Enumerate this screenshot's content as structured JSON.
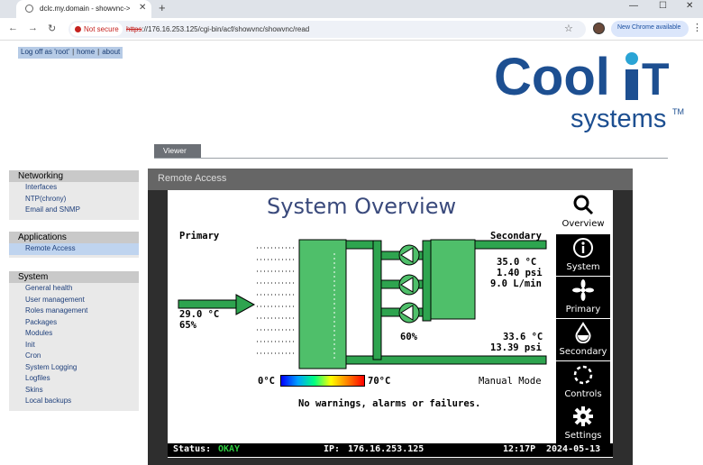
{
  "browser": {
    "tab_title": "dclc.my.domain - showvnc->re",
    "security_label": "Not secure",
    "url_scheme": "https",
    "url_rest": "://176.16.253.125/cgi-bin/acf/showvnc/showvnc/read",
    "new_chrome": "New Chrome available"
  },
  "top_links": [
    "Log off as 'root'",
    "home",
    "about"
  ],
  "logo": {
    "word1": "Cool",
    "word2": "IT",
    "word3": "systems",
    "tm": "TM"
  },
  "viewer_tab": "Viewer",
  "sidebar": [
    {
      "heading": "Networking",
      "items": [
        "Interfaces",
        "NTP(chrony)",
        "Email and SNMP"
      ]
    },
    {
      "heading": "Applications",
      "items": [
        "Remote Access"
      ]
    },
    {
      "heading": "System",
      "items": [
        "General health",
        "User management",
        "Roles management",
        "Packages",
        "Modules",
        "Init",
        "Cron",
        "System Logging",
        "Logfiles",
        "Skins",
        "Local backups"
      ]
    }
  ],
  "active_item": "Remote Access",
  "remote_access_title": "Remote Access",
  "overview": {
    "title": "System Overview",
    "primary_label": "Primary",
    "secondary_label": "Secondary",
    "inlet_temp": "29.0 °C",
    "inlet_humidity": "65%",
    "sec_temp_top": "35.0 °C",
    "sec_pressure_top": "1.40 psi",
    "sec_flow": "9.0 L/min",
    "pump_speed": "60%",
    "sec_temp_bottom": "33.6 °C",
    "sec_pressure_bottom": "13.39 psi",
    "scale_min": "0°C",
    "scale_max": "70°C",
    "mode": "Manual Mode",
    "message": "No warnings, alarms or failures."
  },
  "side_buttons": [
    "Overview",
    "System",
    "Primary",
    "Secondary",
    "Controls",
    "Settings"
  ],
  "status_bar": {
    "status_label": "Status:",
    "status_value": "OKAY",
    "ip_label": "IP:",
    "ip": "176.16.253.125",
    "time": "12:17P",
    "date": "2024-05-13"
  },
  "colors": {
    "accent_green": "#2ea44f",
    "logo_blue": "#1d4f91",
    "title_blue": "#3a4a7c",
    "ok_green": "#2ecc40"
  }
}
